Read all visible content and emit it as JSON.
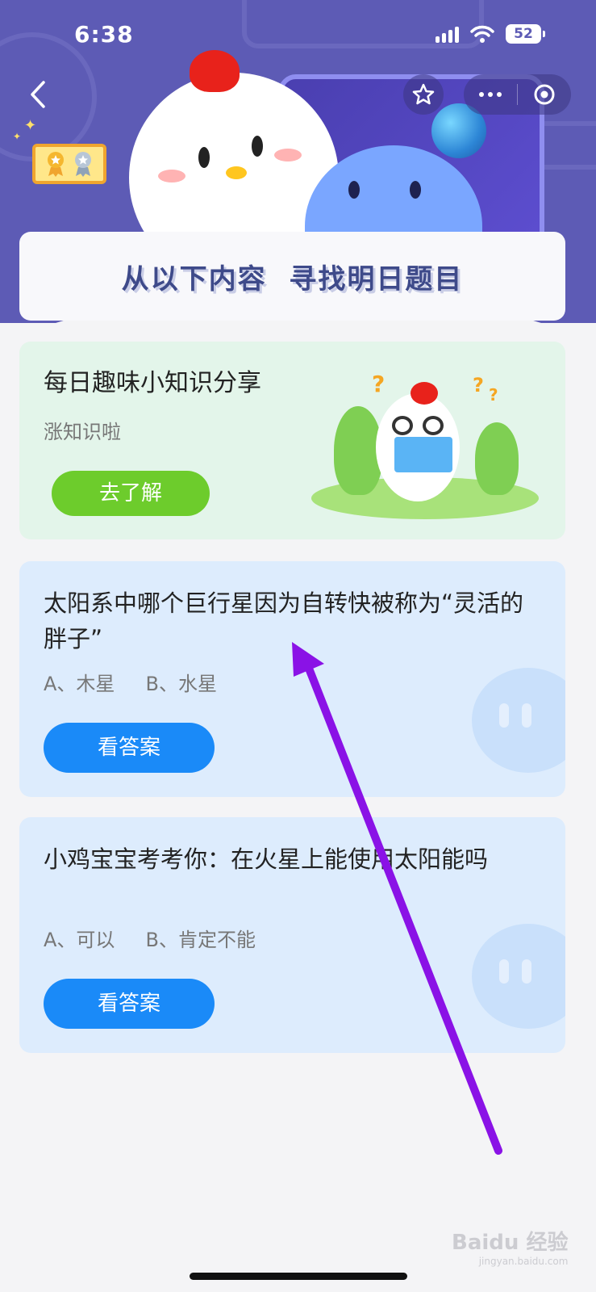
{
  "status_bar": {
    "time": "6:38",
    "battery": "52"
  },
  "banner": {
    "title": "从以下内容  寻找明日题目"
  },
  "knowledge_card": {
    "title": "每日趣味小知识分享",
    "subtitle": "涨知识啦",
    "button_label": "去了解"
  },
  "questions": [
    {
      "title": "太阳系中哪个巨行星因为自转快被称为“灵活的胖子”",
      "options": "A、木星     B、水星",
      "button_label": "看答案"
    },
    {
      "title": "小鸡宝宝考考你：在火星上能使用太阳能吗",
      "options": "A、可以     B、肯定不能",
      "button_label": "看答案"
    }
  ],
  "watermark": {
    "brand": "Baidu 经验",
    "domain": "jingyan.baidu.com"
  },
  "colors": {
    "header_bg": "#5d5bb5",
    "green_button": "#6dcc2c",
    "blue_button": "#1a8af8",
    "annotation_arrow": "#8a12e6"
  }
}
